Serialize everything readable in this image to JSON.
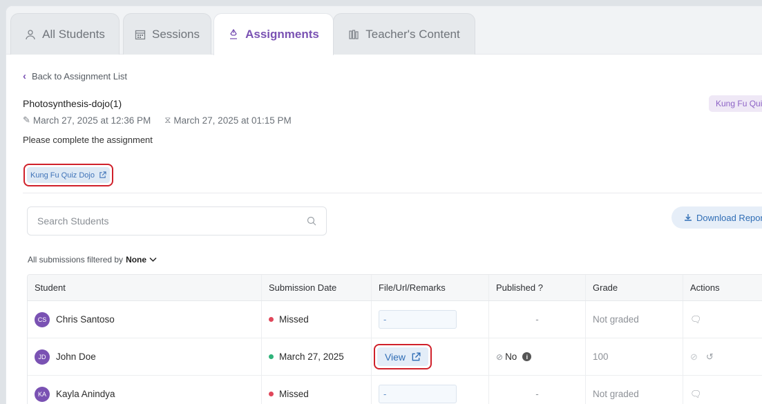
{
  "tabs": [
    {
      "label": "All Students",
      "icon": "students-icon",
      "active": false
    },
    {
      "label": "Sessions",
      "icon": "calendar-icon",
      "active": false
    },
    {
      "label": "Assignments",
      "icon": "pen-icon",
      "active": true
    },
    {
      "label": "Teacher's Content",
      "icon": "library-icon",
      "active": false
    }
  ],
  "back_label": "Back to Assignment List",
  "assignment": {
    "title": "Photosynthesis-dojo(1)",
    "start": "March 27, 2025 at 12:36 PM",
    "due": "March 27, 2025 at 01:15 PM",
    "description": "Please complete the assignment",
    "tag_right": "Kung Fu Quiz",
    "link_label": "Kung Fu Quiz Dojo"
  },
  "search": {
    "placeholder": "Search Students"
  },
  "download_label": "Download Report",
  "filter": {
    "prefix": "All submissions filtered by",
    "value": "None"
  },
  "table": {
    "headers": [
      "Student",
      "Submission Date",
      "File/Url/Remarks",
      "Published ?",
      "Grade",
      "Actions"
    ],
    "rows": [
      {
        "initials": "CS",
        "name": "Chris Santoso",
        "status": "Missed",
        "status_color": "#e0475a",
        "remarks": "-",
        "published": "-",
        "grade": "Not graded"
      },
      {
        "initials": "JD",
        "name": "John Doe",
        "status": "March 27, 2025",
        "status_color": "#2fb37a",
        "remarks": "View",
        "published": "No",
        "grade": "100"
      },
      {
        "initials": "KA",
        "name": "Kayla Anindya",
        "status": "Missed",
        "status_color": "#e0475a",
        "remarks": "-",
        "published": "-",
        "grade": "Not graded"
      }
    ]
  },
  "colors": {
    "accent": "#7a52b3",
    "link": "#2f6db5",
    "highlight": "#d0202a"
  }
}
